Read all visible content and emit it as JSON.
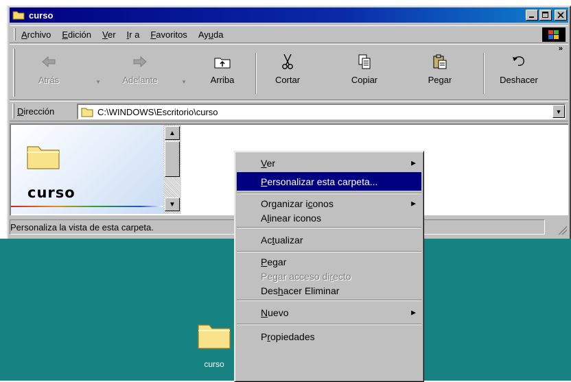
{
  "window": {
    "title": "curso",
    "menu": [
      "Archivo",
      "Edición",
      "Ver",
      "Ir a",
      "Favoritos",
      "Ayuda"
    ],
    "toolbar": [
      {
        "label": "Atrás",
        "icon": "back-arrow-icon",
        "enabled": false
      },
      {
        "label": "Adelante",
        "icon": "forward-arrow-icon",
        "enabled": false
      },
      {
        "label": "Arriba",
        "icon": "up-folder-icon",
        "enabled": true
      },
      {
        "label": "Cortar",
        "icon": "scissors-icon",
        "enabled": true
      },
      {
        "label": "Copiar",
        "icon": "copy-icon",
        "enabled": true
      },
      {
        "label": "Pegar",
        "icon": "paste-icon",
        "enabled": true
      },
      {
        "label": "Deshacer",
        "icon": "undo-icon",
        "enabled": true
      }
    ],
    "address": {
      "label": "Dirección",
      "value": "C:\\WINDOWS\\Escritorio\\curso"
    },
    "webview": {
      "folder_title": "curso"
    },
    "status": "Personaliza la vista de esta carpeta."
  },
  "desktop": {
    "icon_label": "curso",
    "background_color": "#168282"
  },
  "context_menu": {
    "items": [
      {
        "label": "Ver",
        "submenu": true
      },
      {
        "label": "Personalizar esta carpeta...",
        "selected": true
      },
      {
        "label": "Organizar iconos",
        "submenu": true
      },
      {
        "label": "Alinear iconos"
      },
      {
        "label": "Actualizar"
      },
      {
        "label": "Pegar"
      },
      {
        "label": "Pegar acceso directo",
        "disabled": true
      },
      {
        "label": "Deshacer Eliminar"
      },
      {
        "label": "Nuevo",
        "submenu": true
      },
      {
        "label": "Propiedades"
      }
    ]
  }
}
